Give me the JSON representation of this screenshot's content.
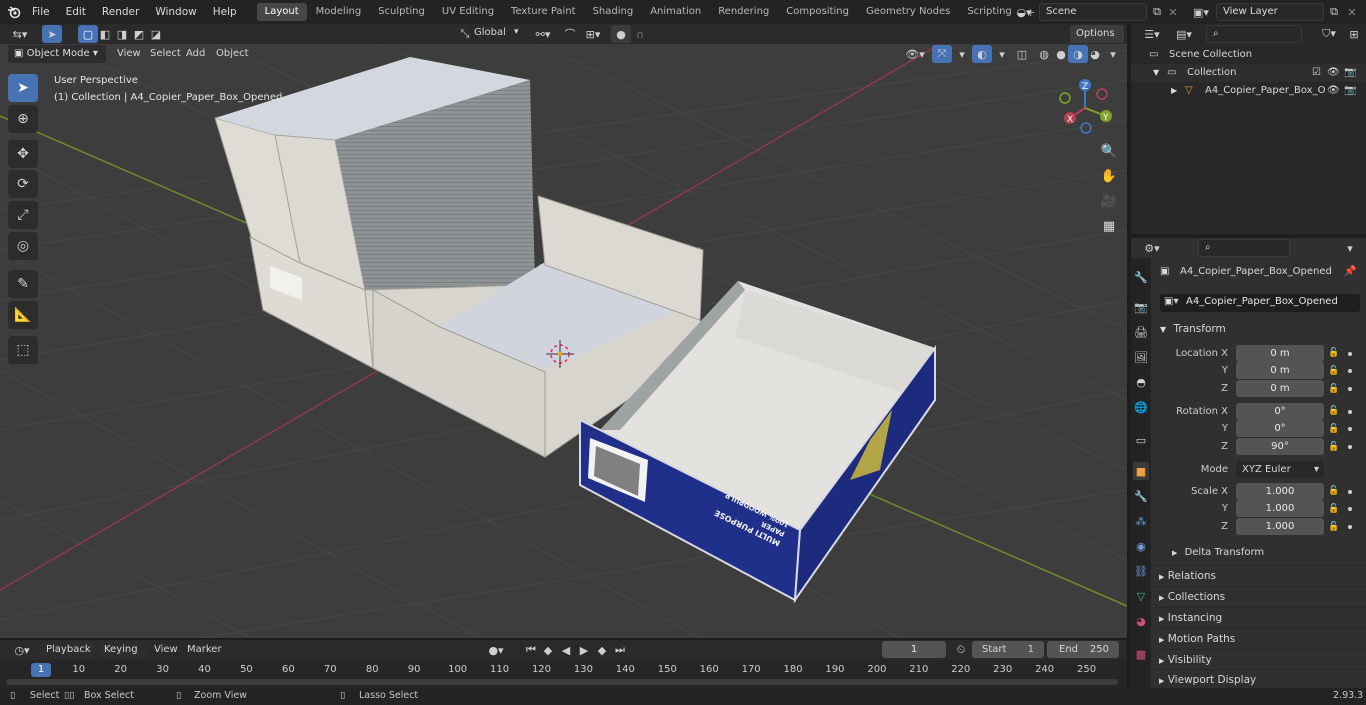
{
  "topbar": {
    "menus": [
      "File",
      "Edit",
      "Render",
      "Window",
      "Help"
    ],
    "workspaces": [
      "Layout",
      "Modeling",
      "Sculpting",
      "UV Editing",
      "Texture Paint",
      "Shading",
      "Animation",
      "Rendering",
      "Compositing",
      "Geometry Nodes",
      "Scripting"
    ],
    "active_workspace": "Layout",
    "add_workspace": "+",
    "scene": "Scene",
    "view_layer": "View Layer"
  },
  "viewport_header": {
    "mode": "Object Mode",
    "menus": [
      "View",
      "Select",
      "Add",
      "Object"
    ],
    "orientation": "Global",
    "options": "Options"
  },
  "viewport": {
    "perspective": "User Perspective",
    "collection_info": "(1) Collection | A4_Copier_Paper_Box_Opened",
    "box_print_line1": "MULTI PURPOSE",
    "box_print_line2": "PAPER",
    "box_print_line3": "100% WOODPULP"
  },
  "gizmo": {
    "z": "Z",
    "y": "Y",
    "x": "X"
  },
  "outliner": {
    "scene_collection": "Scene Collection",
    "collection": "Collection",
    "object": "A4_Copier_Paper_Box_O"
  },
  "properties": {
    "object_name": "A4_Copier_Paper_Box_Opened",
    "object_field": "A4_Copier_Paper_Box_Opened",
    "transform_title": "Transform",
    "location_label": "Location X",
    "rotation_label": "Rotation X",
    "scale_label": "Scale X",
    "y_label": "Y",
    "z_label": "Z",
    "location": [
      "0 m",
      "0 m",
      "0 m"
    ],
    "rotation": [
      "0°",
      "0°",
      "90°"
    ],
    "scale": [
      "1.000",
      "1.000",
      "1.000"
    ],
    "mode_label": "Mode",
    "mode_value": "XYZ Euler",
    "delta_transform": "Delta Transform",
    "sections": [
      "Relations",
      "Collections",
      "Instancing",
      "Motion Paths",
      "Visibility",
      "Viewport Display"
    ]
  },
  "timeline": {
    "menus": [
      "Playback",
      "Keying",
      "View",
      "Marker"
    ],
    "current_frame": "1",
    "start_label": "Start",
    "start": "1",
    "end_label": "End",
    "end": "250",
    "ruler": [
      "1",
      "10",
      "20",
      "30",
      "40",
      "50",
      "60",
      "70",
      "80",
      "90",
      "100",
      "110",
      "120",
      "130",
      "140",
      "150",
      "160",
      "170",
      "180",
      "190",
      "200",
      "210",
      "220",
      "230",
      "240",
      "250"
    ]
  },
  "statusbar": {
    "select": "Select",
    "box_select": "Box Select",
    "zoom_view": "Zoom View",
    "lasso_select": "Lasso Select",
    "version": "2.93.3"
  },
  "colors": {
    "accent": "#4772b3",
    "x_axis": "#b5404f",
    "y_axis": "#7fa32a",
    "z_axis": "#3f79c6",
    "box_blue": "#1f2f8a"
  }
}
